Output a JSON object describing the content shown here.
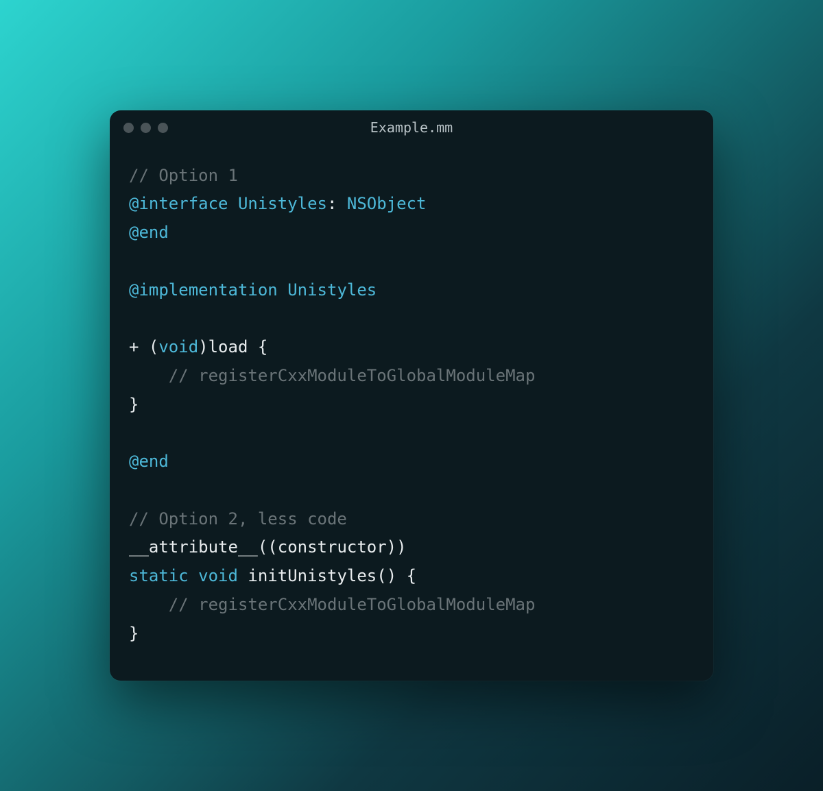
{
  "window": {
    "title": "Example.mm"
  },
  "code": {
    "l1_comment": "// Option 1",
    "l2_kw": "@interface",
    "l2_space1": " ",
    "l2_type1": "Unistyles",
    "l2_colon": ": ",
    "l2_type2": "NSObject",
    "l3_kw": "@end",
    "blank1": "",
    "l5_kw": "@implementation",
    "l5_space": " ",
    "l5_type": "Unistyles",
    "blank2": "",
    "l7_plus": "+ (",
    "l7_void": "void",
    "l7_rest": ")load {",
    "l8_indent": "    ",
    "l8_comment": "// registerCxxModuleToGlobalModuleMap",
    "l9_brace": "}",
    "blank3": "",
    "l11_kw": "@end",
    "blank4": "",
    "l13_comment": "// Option 2, less code",
    "l14_attr": "__attribute__",
    "l14_rest": "((constructor))",
    "l15_kw1": "static",
    "l15_sp1": " ",
    "l15_kw2": "void",
    "l15_sp2": " ",
    "l15_rest": "initUnistyles() {",
    "l16_indent": "    ",
    "l16_comment": "// registerCxxModuleToGlobalModuleMap",
    "l17_brace": "}"
  }
}
